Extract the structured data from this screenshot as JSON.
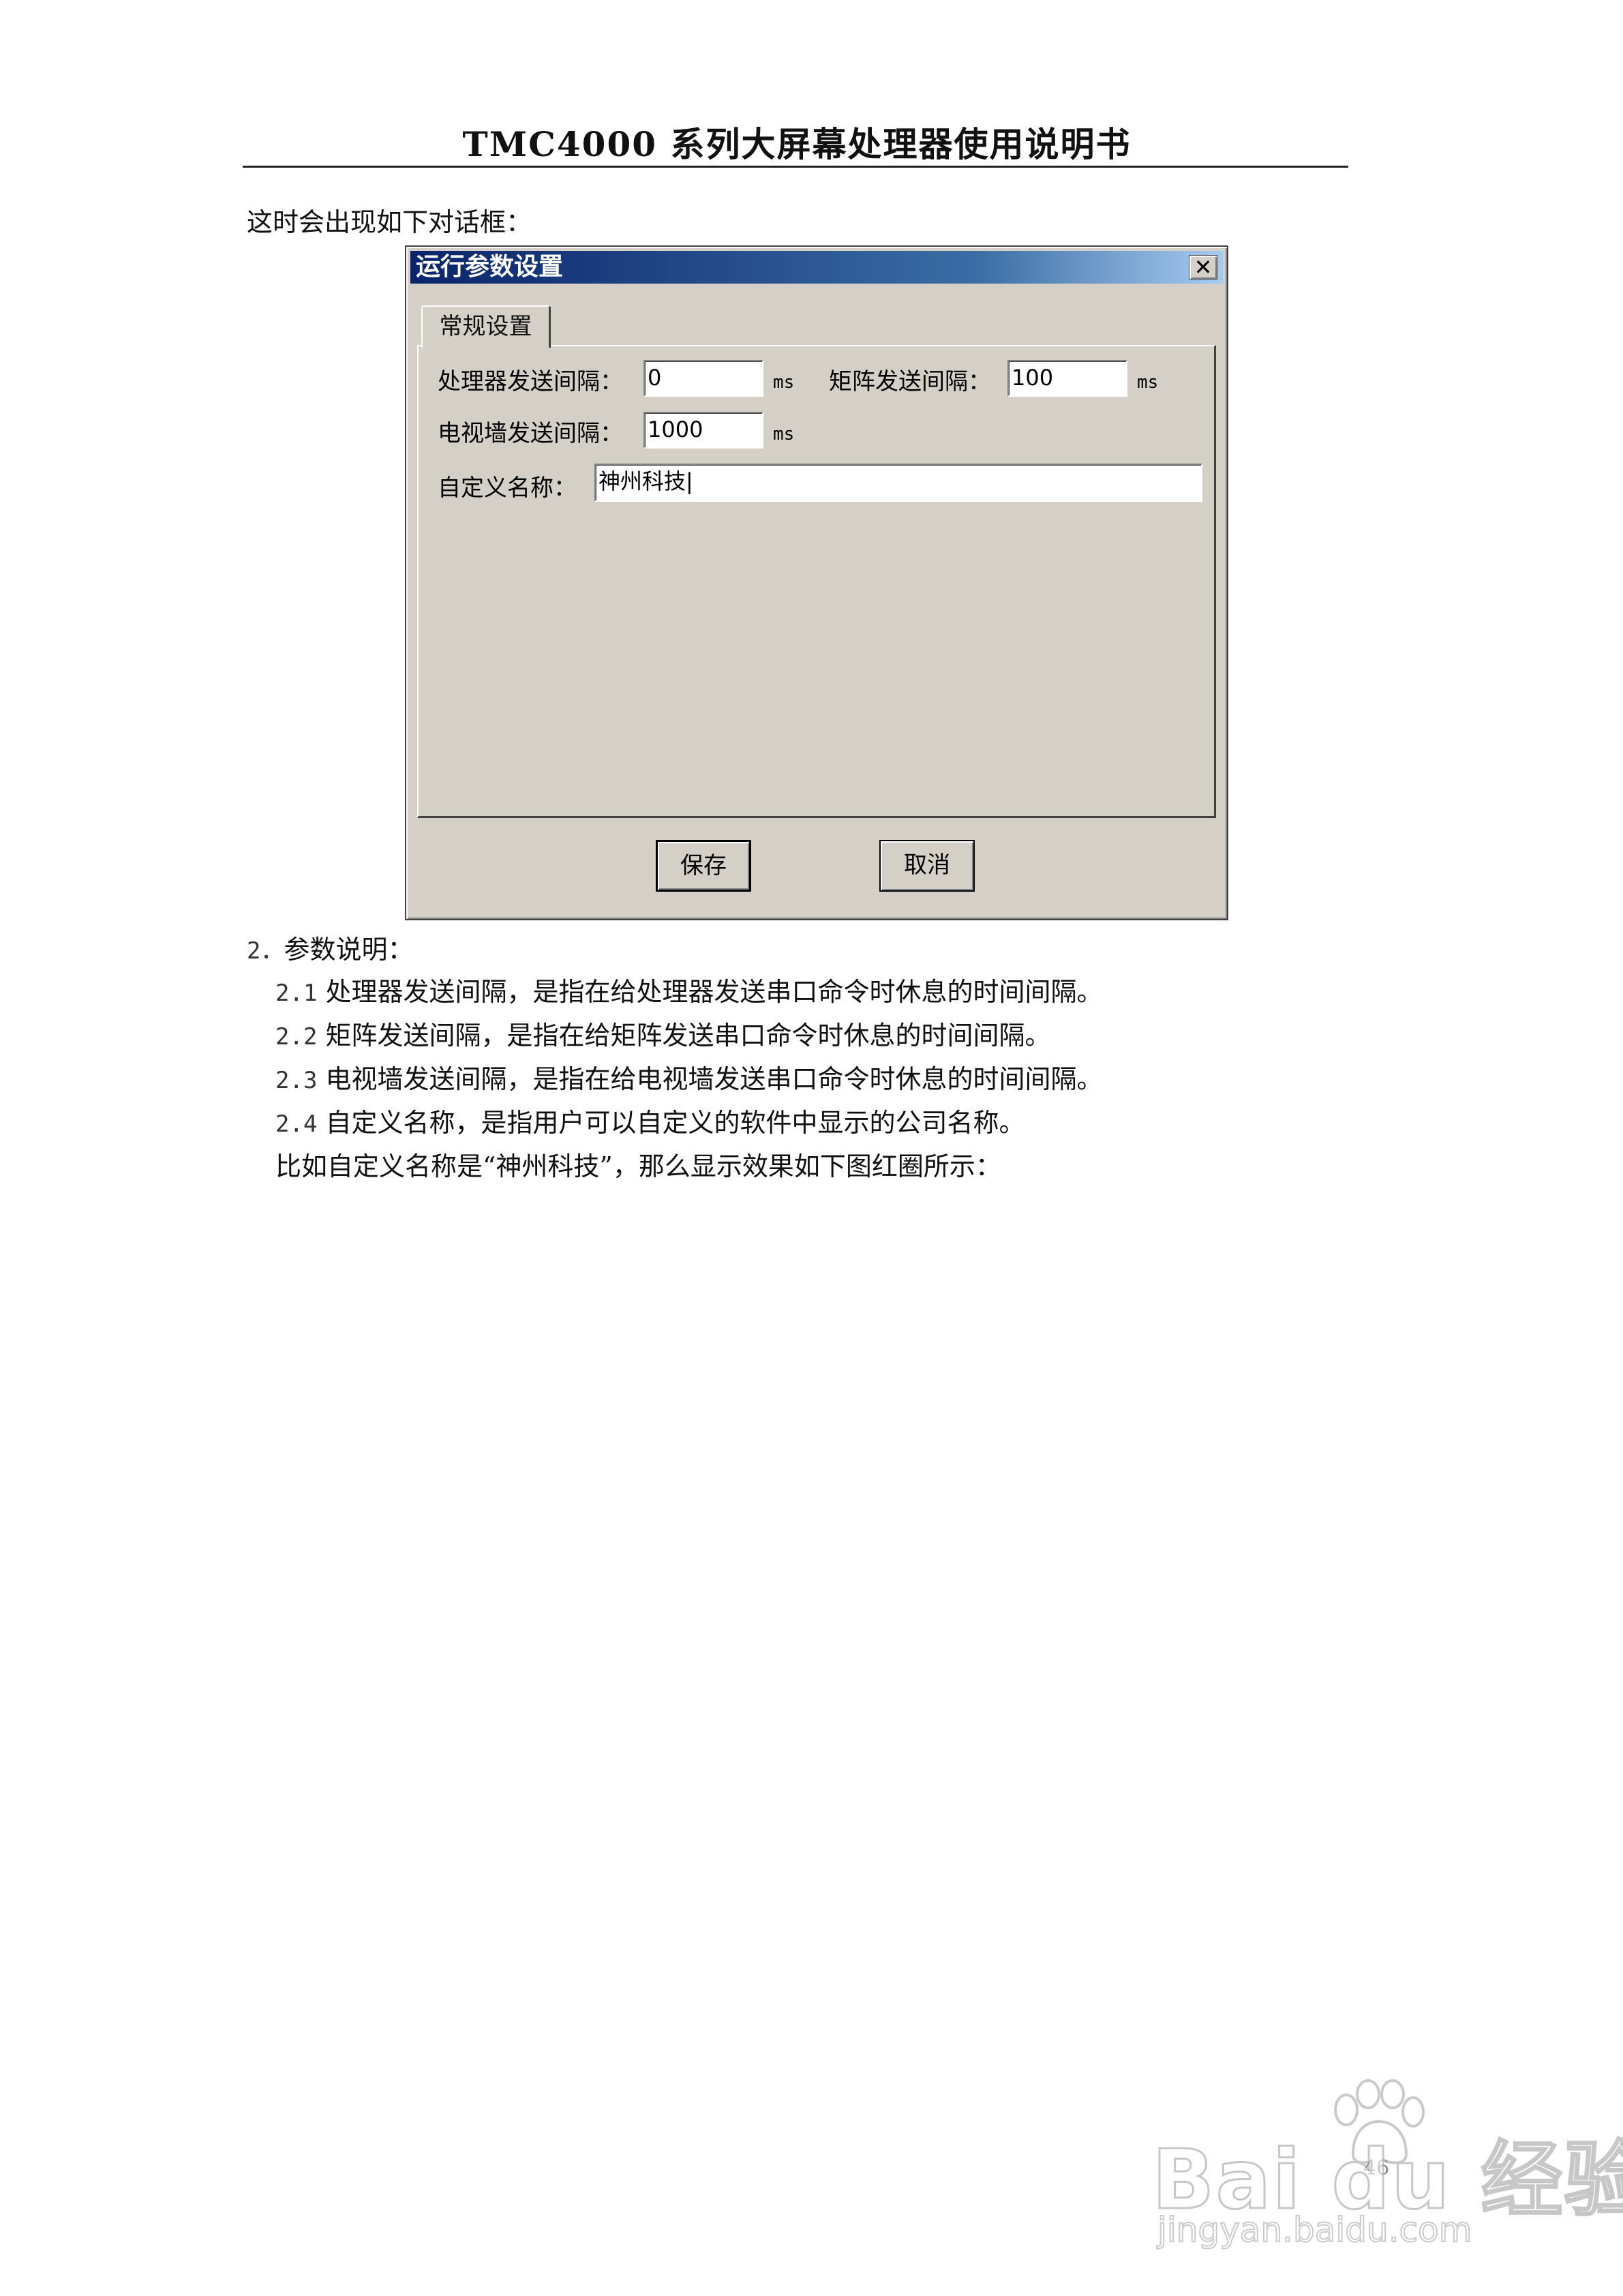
{
  "header": {
    "title": "TMC4000 系列大屏幕处理器使用说明书"
  },
  "intro": "这时会出现如下对话框：",
  "dialog": {
    "title": "运行参数设置",
    "close_glyph": "✕",
    "tab_label": "常规设置",
    "fields": {
      "processor_interval_label": "处理器发送间隔：",
      "processor_interval_value": "0",
      "matrix_interval_label": "矩阵发送间隔：",
      "matrix_interval_value": "100",
      "tvwall_interval_label": "电视墙发送间隔：",
      "tvwall_interval_value": "1000",
      "custom_name_label": "自定义名称：",
      "custom_name_value": "神州科技|",
      "unit": "ms"
    },
    "buttons": {
      "save": "保存",
      "cancel": "取消"
    }
  },
  "section": {
    "heading_num": "2．",
    "heading_text": "参数说明：",
    "items": [
      {
        "num": "2.1",
        "text": "处理器发送间隔，是指在给处理器发送串口命令时休息的时间间隔。"
      },
      {
        "num": "2.2",
        "text": "矩阵发送间隔，是指在给矩阵发送串口命令时休息的时间间隔。"
      },
      {
        "num": "2.3",
        "text": "电视墙发送间隔，是指在给电视墙发送串口命令时休息的时间间隔。"
      },
      {
        "num": "2.4",
        "text": "自定义名称，是指用户可以自定义的软件中显示的公司名称。"
      }
    ],
    "example": "比如自定义名称是“神州科技”，那么显示效果如下图红圈所示："
  },
  "page_number": "46",
  "watermark": {
    "logo": "Bai du 经验",
    "url": "jingyan.baidu.com"
  }
}
